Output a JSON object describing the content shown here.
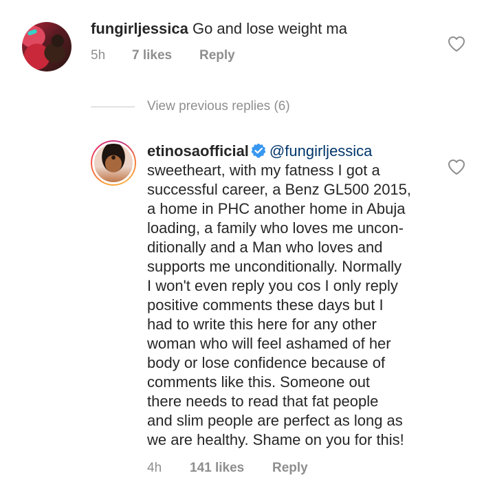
{
  "first_comment": {
    "username": "fungirljessica",
    "text": "Go and lose weight ma",
    "time": "5h",
    "likes": "7 likes",
    "reply": "Reply"
  },
  "thread": {
    "view_previous_replies": "View previous replies (6)"
  },
  "reply_comment": {
    "username": "etinosaofficial",
    "verified": true,
    "mention": "@fungirljessica",
    "lines": [
      "sweetheart, with my fatness I got a",
      "successful career, a Benz GL500 2015,",
      "a home in PHC another home in Abuja",
      "loading, a family who loves me uncon-",
      "ditionally and a Man who loves and",
      "supports me unconditionally. Normally",
      "I won't even reply you cos I only reply",
      "positive comments these days but I",
      "had to write this here for any other",
      "woman who will feel ashamed of her",
      "body or lose confidence because of",
      "comments like this. Someone out",
      "there needs to read that fat people",
      "and slim people are perfect as long as",
      "we are healthy. Shame on you for this!"
    ],
    "time": "4h",
    "likes": "141 likes",
    "reply": "Reply"
  },
  "icons": {
    "like": "heart-outline-icon",
    "verified": "verified-badge-icon"
  },
  "colors": {
    "text": "#262626",
    "secondary": "#8e8e8e",
    "mention": "#003569",
    "verified": "#3897f0"
  }
}
